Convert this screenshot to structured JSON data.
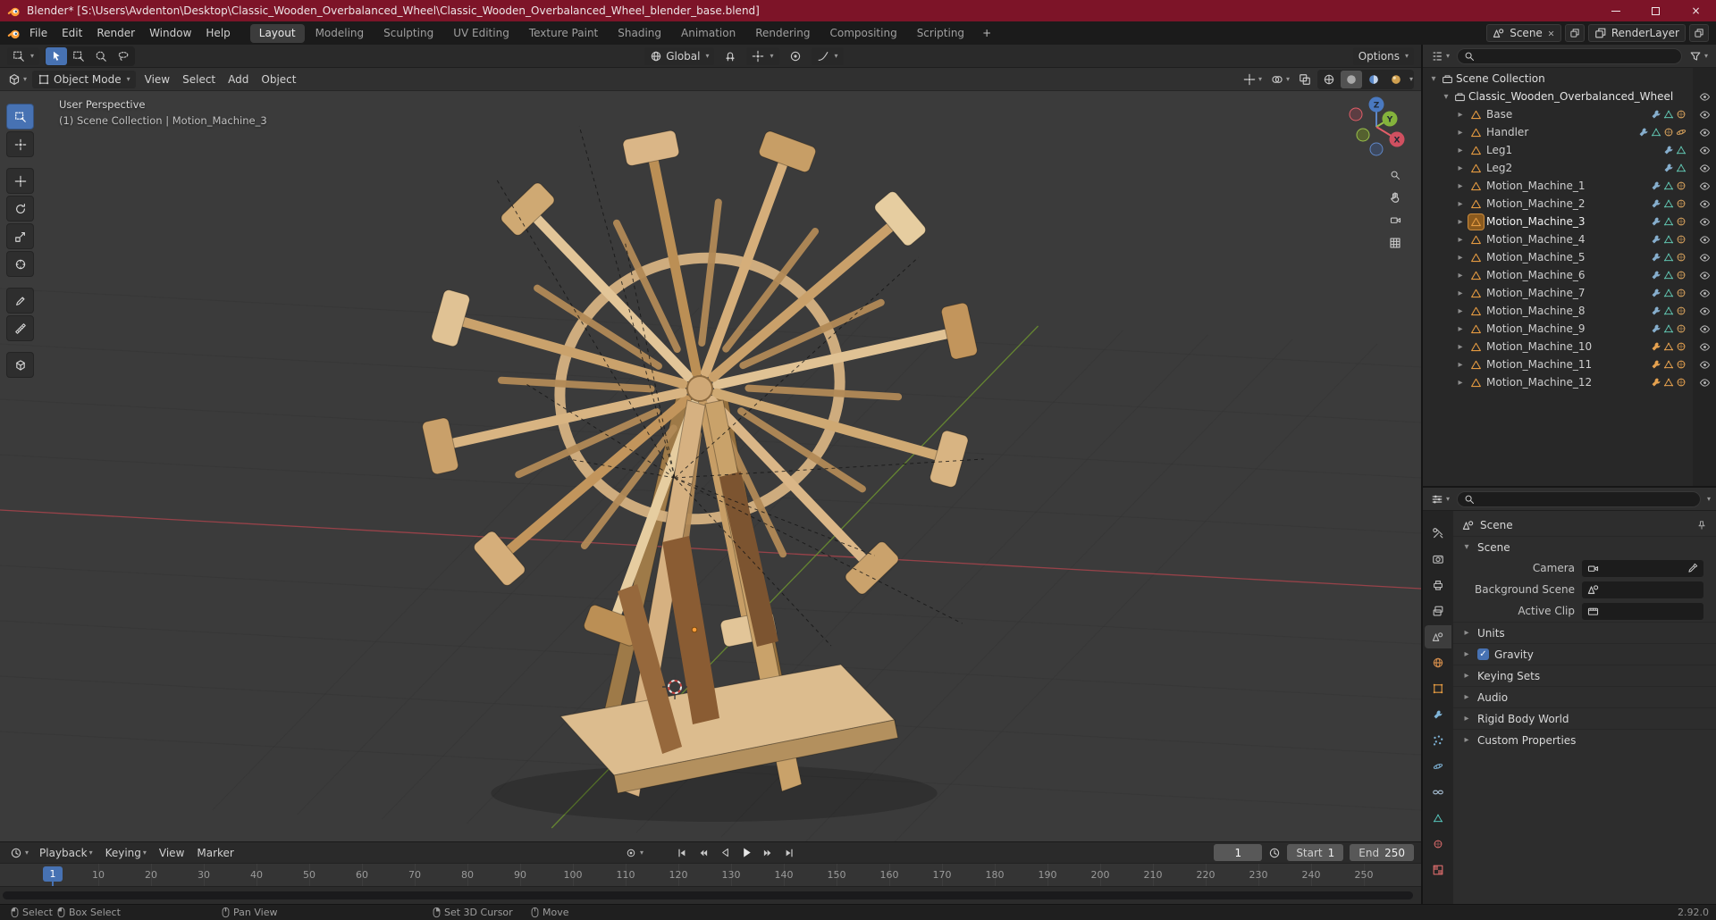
{
  "colors": {
    "accent_blue": "#4772b3",
    "selection_orange": "#e59b41",
    "axis_x": "#a8444c",
    "axis_y": "#6d9330",
    "titlebar": "#7d1428"
  },
  "titlebar": {
    "title": "Blender* [S:\\Users\\Avdenton\\Desktop\\Classic_Wooden_Overbalanced_Wheel\\Classic_Wooden_Overbalanced_Wheel_blender_base.blend]"
  },
  "menubar": {
    "menus": [
      "File",
      "Edit",
      "Render",
      "Window",
      "Help"
    ],
    "workspaces": [
      "Layout",
      "Modeling",
      "Sculpting",
      "UV Editing",
      "Texture Paint",
      "Shading",
      "Animation",
      "Rendering",
      "Compositing",
      "Scripting"
    ],
    "active_workspace": "Layout",
    "add_tab": "+",
    "scene": "Scene",
    "view_layer": "RenderLayer"
  },
  "tool_settings": {
    "orientation": "Global",
    "options": "Options"
  },
  "viewport": {
    "mode": "Object Mode",
    "menus": [
      "View",
      "Select",
      "Add",
      "Object"
    ],
    "perspective_label": "User Perspective",
    "context_label": "(1) Scene Collection | Motion_Machine_3",
    "axis_labels": {
      "x": "X",
      "y": "Y",
      "z": "Z"
    }
  },
  "outliner": {
    "root": "Scene Collection",
    "collection": "Classic_Wooden_Overbalanced_Wheel",
    "objects": [
      {
        "label": "Base",
        "icons": [
          "modifier-wrench-icon",
          "mesh-data-icon",
          "material-icon"
        ]
      },
      {
        "label": "Handler",
        "icons": [
          "modifier-wrench-icon",
          "mesh-data-icon",
          "material-icon",
          "physics-icon"
        ]
      },
      {
        "label": "Leg1",
        "icons": [
          "modifier-wrench-icon",
          "mesh-data-icon"
        ]
      },
      {
        "label": "Leg2",
        "icons": [
          "modifier-wrench-icon",
          "mesh-data-icon"
        ]
      },
      {
        "label": "Motion_Machine_1",
        "icons": [
          "modifier-wrench-icon",
          "mesh-data-icon",
          "material-icon"
        ]
      },
      {
        "label": "Motion_Machine_2",
        "icons": [
          "modifier-wrench-icon",
          "mesh-data-icon",
          "material-icon"
        ]
      },
      {
        "label": "Motion_Machine_3",
        "active": true,
        "icons": [
          "modifier-wrench-icon",
          "mesh-data-icon",
          "material-icon"
        ]
      },
      {
        "label": "Motion_Machine_4",
        "icons": [
          "modifier-wrench-icon",
          "mesh-data-icon",
          "material-icon"
        ]
      },
      {
        "label": "Motion_Machine_5",
        "icons": [
          "modifier-wrench-icon",
          "mesh-data-icon",
          "material-icon"
        ]
      },
      {
        "label": "Motion_Machine_6",
        "icons": [
          "modifier-wrench-icon",
          "mesh-data-icon",
          "material-icon"
        ]
      },
      {
        "label": "Motion_Machine_7",
        "icons": [
          "modifier-wrench-icon",
          "mesh-data-icon",
          "material-icon"
        ]
      },
      {
        "label": "Motion_Machine_8",
        "icons": [
          "modifier-wrench-icon",
          "mesh-data-icon",
          "material-icon"
        ]
      },
      {
        "label": "Motion_Machine_9",
        "icons": [
          "modifier-wrench-icon",
          "mesh-data-icon",
          "material-icon"
        ]
      },
      {
        "label": "Motion_Machine_10",
        "selected": true,
        "icons": [
          "modifier-wrench-icon",
          "mesh-data-icon",
          "material-icon"
        ]
      },
      {
        "label": "Motion_Machine_11",
        "selected": true,
        "icons": [
          "modifier-wrench-icon",
          "mesh-data-icon",
          "material-icon"
        ]
      },
      {
        "label": "Motion_Machine_12",
        "selected": true,
        "icons": [
          "modifier-wrench-icon",
          "mesh-data-icon",
          "material-icon"
        ]
      }
    ]
  },
  "properties": {
    "breadcrumb": "Scene",
    "scene_panel": {
      "title": "Scene",
      "fields": [
        {
          "label": "Camera",
          "icon": "camera-data-icon",
          "value": "",
          "eyedropper": true
        },
        {
          "label": "Background Scene",
          "icon": "scene-icon",
          "value": ""
        },
        {
          "label": "Active Clip",
          "icon": "film-icon",
          "value": ""
        }
      ]
    },
    "panels": [
      {
        "label": "Units"
      },
      {
        "label": "Gravity",
        "checkbox": true,
        "checked": true
      },
      {
        "label": "Keying Sets"
      },
      {
        "label": "Audio"
      },
      {
        "label": "Rigid Body World"
      },
      {
        "label": "Custom Properties"
      }
    ],
    "tabs": [
      {
        "icon": "tool-icon"
      },
      {
        "icon": "render-icon"
      },
      {
        "icon": "output-icon"
      },
      {
        "icon": "viewlayer-icon"
      },
      {
        "icon": "scene-tab-icon",
        "active": true
      },
      {
        "icon": "world-icon",
        "color": "#cf8a4a"
      },
      {
        "icon": "object-icon",
        "color": "#e59b41"
      },
      {
        "icon": "modifier-wrench-icon",
        "color": "#7fb4d8"
      },
      {
        "icon": "particles-icon",
        "color": "#7fb4d8"
      },
      {
        "icon": "physics-icon",
        "color": "#7fb4d8"
      },
      {
        "icon": "constraints-icon",
        "color": "#9fb5c9"
      },
      {
        "icon": "data-icon",
        "color": "#55c1b8"
      },
      {
        "icon": "material-icon",
        "color": "#d96a6a"
      },
      {
        "icon": "texture-icon",
        "color": "#d96a6a"
      }
    ]
  },
  "timeline": {
    "menus": [
      "Playback",
      "Keying",
      "View",
      "Marker"
    ],
    "current_frame": "1",
    "start_label": "Start",
    "start_value": "1",
    "end_label": "End",
    "end_value": "250",
    "marker_frame": "1",
    "ticks": [
      "10",
      "20",
      "30",
      "40",
      "50",
      "60",
      "70",
      "80",
      "90",
      "100",
      "110",
      "120",
      "130",
      "140",
      "150",
      "160",
      "170",
      "180",
      "190",
      "200",
      "210",
      "220",
      "230",
      "240",
      "250"
    ]
  },
  "statusbar": {
    "hints": [
      {
        "icon": "mouse-left-icon",
        "label": "Select"
      },
      {
        "icon": "mouse-left-drag-icon",
        "label": "Box Select"
      },
      {
        "icon": "mouse-middle-icon",
        "label": "Pan View"
      },
      {
        "icon": "mouse-right-icon",
        "label": "Set 3D Cursor"
      },
      {
        "icon": "mouse-move-icon",
        "label": "Move"
      }
    ],
    "version": "2.92.0"
  }
}
